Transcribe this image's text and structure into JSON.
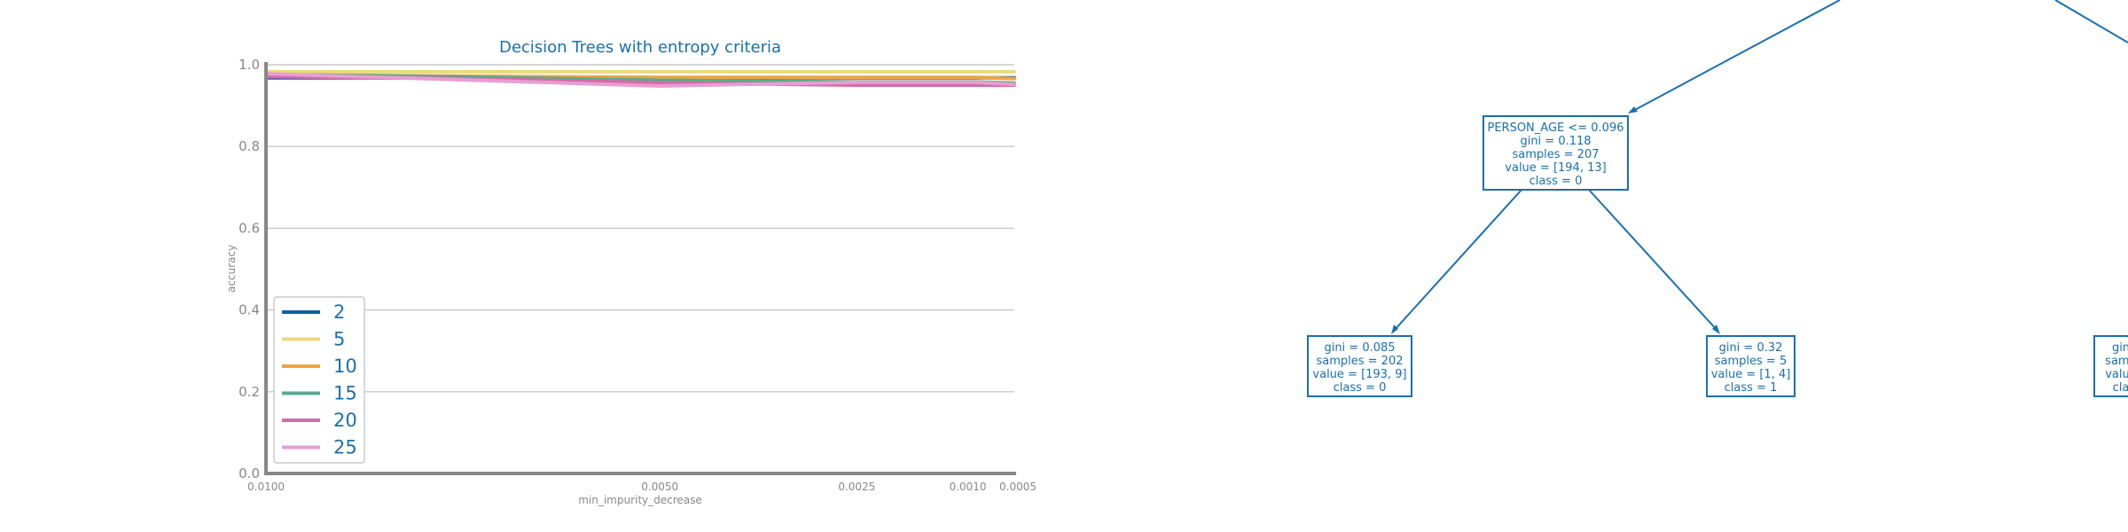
{
  "chart_data": {
    "type": "line",
    "title": "Decision Trees with entropy criteria",
    "xlabel": "min_impurity_decrease",
    "ylabel": "accuracy",
    "x": [
      0.01,
      0.0075,
      0.005,
      0.0025,
      0.001,
      0.0005
    ],
    "x_tick_labels": [
      "0.0100",
      "0.0050",
      "0.0025",
      "0.0010",
      "0.0005"
    ],
    "x_tick_values": [
      0.01,
      0.005,
      0.0025,
      0.001,
      0.0005
    ],
    "y_tick_labels": [
      "0.0",
      "0.2",
      "0.4",
      "0.6",
      "0.8",
      "1.0"
    ],
    "y_tick_values": [
      0.0,
      0.2,
      0.4,
      0.6,
      0.8,
      1.0
    ],
    "xlim": [
      0.01,
      0.0005
    ],
    "ylim": [
      0.0,
      1.0
    ],
    "grid": true,
    "legend_position": "bottom-left",
    "series": [
      {
        "name": "2",
        "color": "#0b62aa",
        "values": [
          0.968,
          0.968,
          0.968,
          0.968,
          0.968,
          0.968
        ]
      },
      {
        "name": "5",
        "color": "#ead97e",
        "values": [
          0.983,
          0.983,
          0.983,
          0.983,
          0.983,
          0.983
        ]
      },
      {
        "name": "10",
        "color": "#efa443",
        "values": [
          0.976,
          0.972,
          0.969,
          0.969,
          0.969,
          0.966
        ]
      },
      {
        "name": "15",
        "color": "#56ad8d",
        "values": [
          0.976,
          0.97,
          0.962,
          0.958,
          0.958,
          0.955
        ]
      },
      {
        "name": "20",
        "color": "#d46ca6",
        "values": [
          0.971,
          0.966,
          0.956,
          0.95,
          0.95,
          0.95
        ]
      },
      {
        "name": "25",
        "color": "#e79ed4",
        "values": [
          0.978,
          0.963,
          0.948,
          0.957,
          0.957,
          0.952
        ]
      }
    ]
  },
  "tree": {
    "nodes": [
      {
        "id": "n1",
        "lines": [
          "PERSON_AGE <= 0.096",
          "gini = 0.118",
          "samples = 207",
          "value = [194, 13]",
          "class = 0"
        ]
      },
      {
        "id": "n2",
        "lines": [
          "gini = 0.085",
          "samples = 202",
          "value = [193, 9]",
          "class = 0"
        ]
      },
      {
        "id": "n3",
        "lines": [
          "gini = 0.32",
          "samples = 5",
          "value = [1, 4]",
          "class = 1"
        ]
      },
      {
        "id": "n4",
        "lines": [
          "gin",
          "samp",
          "value",
          "cla"
        ]
      }
    ]
  }
}
